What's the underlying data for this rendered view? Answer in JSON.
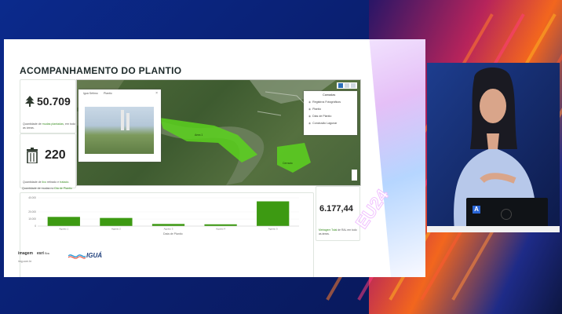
{
  "slide": {
    "title": "ACOMPANHAMENTO DO PLANTIO",
    "kpi_trees": {
      "value": "50.709",
      "caption_pre": "Quantidade de ",
      "caption_hl": "mudas plantadas",
      "caption_post": ", em todo",
      "caption2": "as áreas."
    },
    "kpi_trash": {
      "value": "220",
      "caption_pre": "Quantidade de ",
      "caption_hl": "lixo",
      "caption_post": " retirado e ",
      "caption_hl2": "tratado",
      "caption_end": ".",
      "caption2_pre": "Quantidade de mudas no ",
      "caption2_hl": "Dia de Plantio"
    },
    "kpi_area": {
      "value": "6.177,44",
      "caption_hl": "Metragem Total",
      "caption_post": " de RAL em todo",
      "caption2": "as áreas."
    },
    "map": {
      "popup_tab1": "Iguá Sétimo",
      "popup_tab2": "Plantio",
      "legend_title": "Camadas",
      "legend_items": [
        "Registros Fotográficos",
        "Plantio",
        "Dias de Plantio",
        "Conclusão Lagunar"
      ],
      "label_a": "Area 1",
      "label_b": "Cerrado"
    },
    "chart_axis_label": "Data de Plantio",
    "logo_imagem": "imagem",
    "logo_esri": "esri",
    "logo_esri_suffix": "Bra",
    "logo_igua": "IGUÁ",
    "logo_url": "img.com.br"
  },
  "chart_data": {
    "type": "bar",
    "categories": [
      "Agosto 1",
      "Agosto 2",
      "Agosto 3",
      "Agosto 4",
      "Agosto 5"
    ],
    "values": [
      13000,
      11500,
      3000,
      2500,
      35000
    ],
    "xlabel": "Data de Plantio",
    "ylabel": "",
    "ylim": [
      0,
      40000
    ],
    "yticks": [
      "40.000",
      "20.000",
      "10.000",
      "0"
    ],
    "color": "#3d9a12"
  },
  "event": {
    "badge_line1": "ESRI",
    "badge_line2": "EU24"
  },
  "presenter": {
    "device_logo": "A"
  },
  "colors": {
    "accent_green": "#3d9a12",
    "brand_blue": "#0b2a8c"
  }
}
